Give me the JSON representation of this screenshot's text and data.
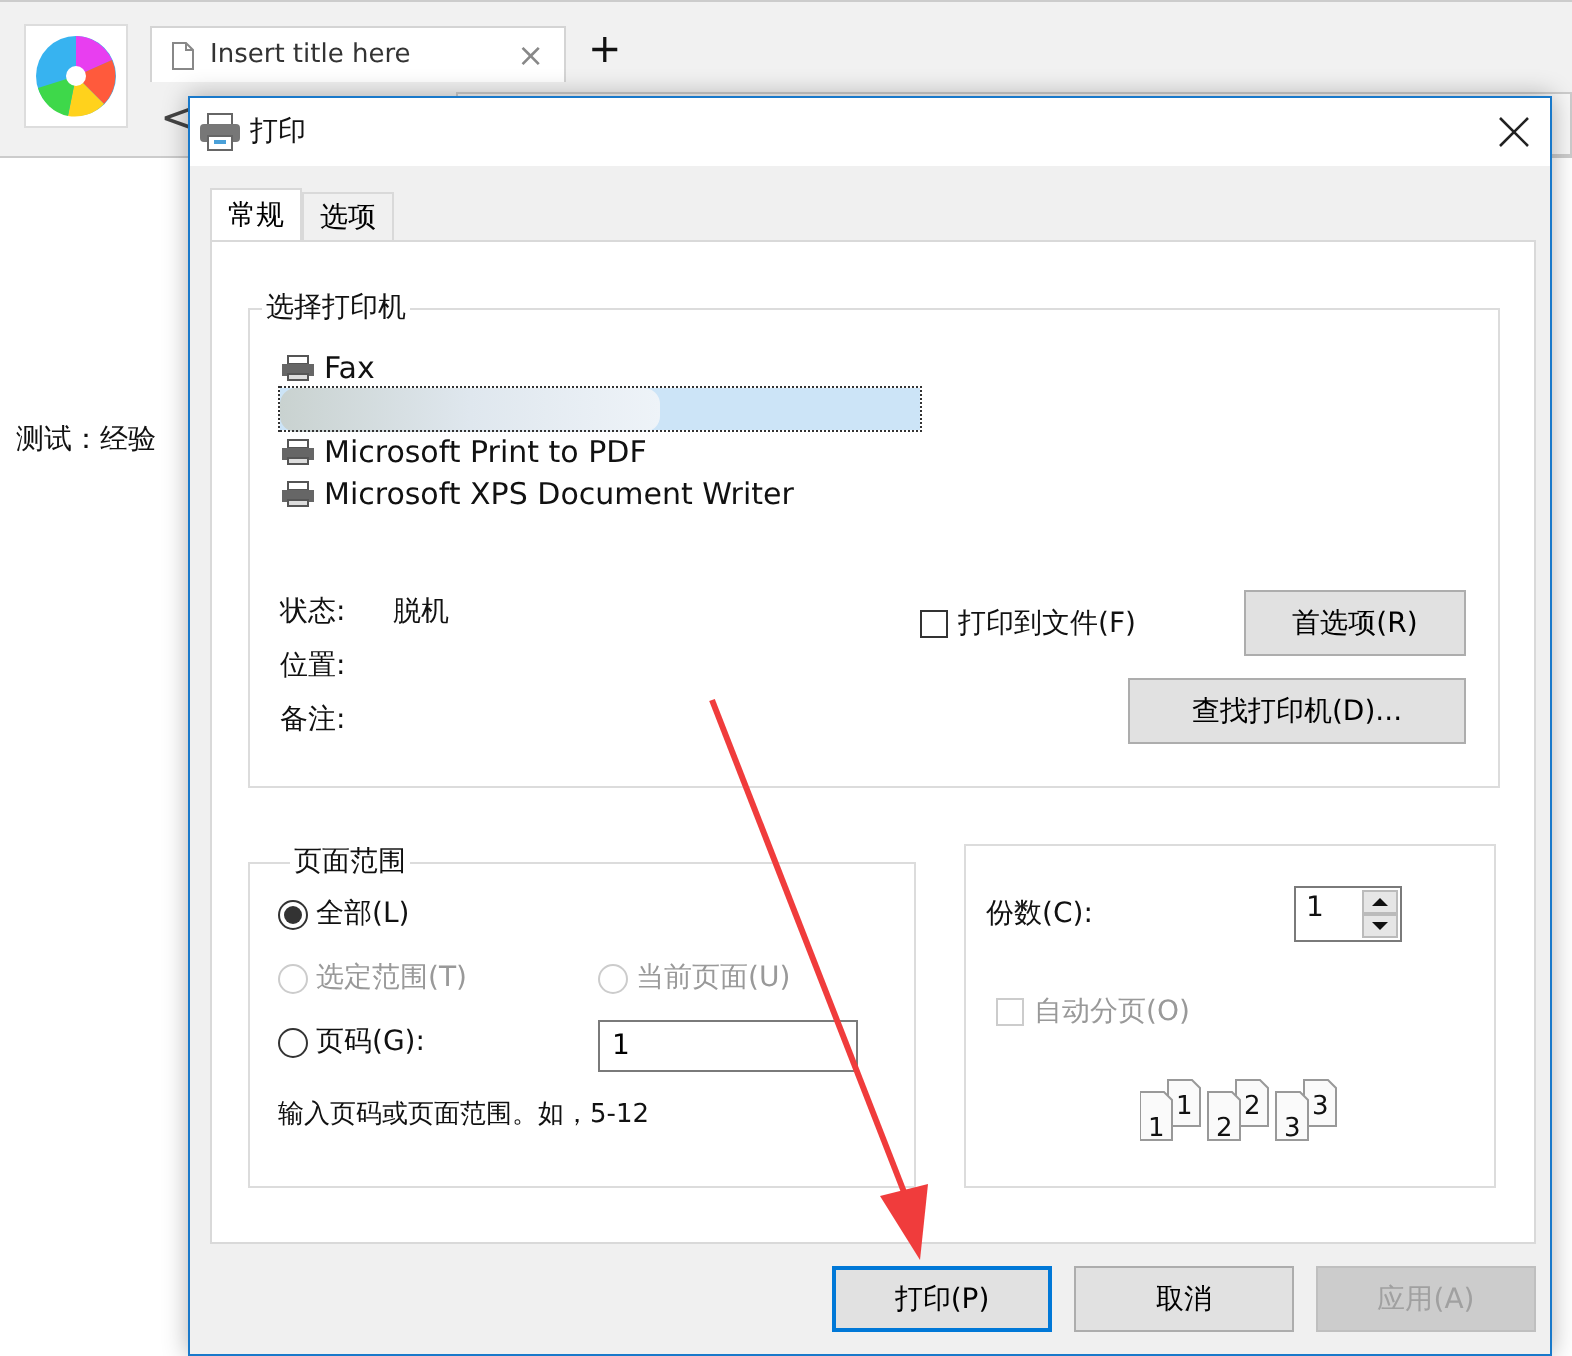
{
  "browser": {
    "tab_title": "Insert title here",
    "tab_close": "×",
    "new_tab": "+",
    "back": "<",
    "page_text": "测试：经验"
  },
  "dialog": {
    "title": "打印",
    "tabs": [
      {
        "label": "常规",
        "selected": true
      },
      {
        "label": "选项",
        "selected": false
      }
    ],
    "printer_group": {
      "legend": "选择打印机",
      "printers": [
        {
          "kind": "printer",
          "name": "Fax",
          "selected": false
        },
        {
          "kind": "redacted",
          "selected": true
        },
        {
          "kind": "printer",
          "name": "Microsoft Print to PDF",
          "selected": false
        },
        {
          "kind": "printer",
          "name": "Microsoft XPS Document Writer",
          "selected": false
        }
      ],
      "info": [
        {
          "label": "状态:",
          "value": "脱机"
        },
        {
          "label": "位置:"
        },
        {
          "label": "备注:"
        }
      ],
      "print_to_file": {
        "label": "打印到文件(F)",
        "checked": false
      },
      "preferences_button": "首选项(R)",
      "find_button": "查找打印机(D)..."
    },
    "page_range": {
      "legend": "页面范围",
      "options": [
        {
          "label": "全部(L)",
          "selected": true,
          "disabled": false
        },
        {
          "label": "选定范围(T)",
          "selected": false,
          "disabled": true
        },
        {
          "label": "当前页面(U)",
          "selected": false,
          "disabled": true
        },
        {
          "label": "页码(G):",
          "selected": false,
          "disabled": false
        }
      ],
      "pages_value": "1",
      "hint": "输入页码或页面范围。如，5-12"
    },
    "copies": {
      "label": "份数(C):",
      "value": "1",
      "collate": {
        "label": "自动分页(O)",
        "checked": false,
        "disabled": true
      },
      "collate_pages": [
        "1",
        "1",
        "2",
        "2",
        "3",
        "3"
      ]
    },
    "buttons": [
      {
        "label": "打印(P)",
        "default": true,
        "disabled": false
      },
      {
        "label": "取消",
        "default": false,
        "disabled": false
      },
      {
        "label": "应用(A)",
        "default": false,
        "disabled": true
      }
    ]
  }
}
